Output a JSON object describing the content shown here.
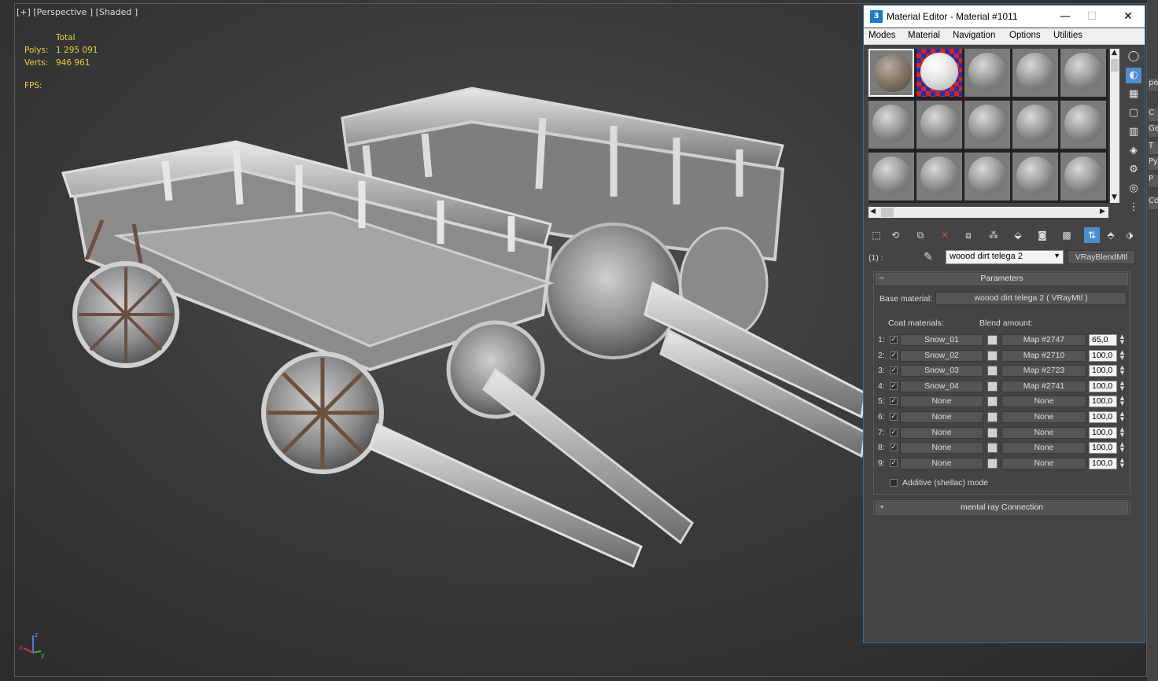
{
  "viewport": {
    "labels": [
      "[+]",
      "[Perspective ]",
      "[Shaded ]"
    ],
    "stats": {
      "header": "Total",
      "polys_label": "Polys:",
      "polys_value": "1 295 091",
      "verts_label": "Verts:",
      "verts_value": "946 961",
      "fps_label": "FPS:"
    },
    "axis": {
      "x": "x",
      "y": "y",
      "z": "z"
    }
  },
  "right_panel": {
    "tabs": [
      "pe",
      "C",
      "Geo",
      "T",
      "Py",
      "P",
      "Colo"
    ]
  },
  "material_editor": {
    "title": "Material Editor - Material #1011",
    "window_buttons": [
      "—",
      "☐",
      "✕"
    ],
    "menu": [
      "Modes",
      "Material",
      "Navigation",
      "Options",
      "Utilities"
    ],
    "slot_label": "(1) :",
    "material_name": "woood dirt telega 2",
    "material_type": "VRayBlendMtl",
    "parameters": {
      "title": "Parameters",
      "base_label": "Base material:",
      "base_value": "woood dirt telega 2  ( VRayMtl )",
      "coat_header": "Coat materials:",
      "blend_header": "Blend amount:",
      "rows": [
        {
          "idx": "1:",
          "coat": "Snow_01",
          "map": "Map #2747",
          "amount": "65,0"
        },
        {
          "idx": "2:",
          "coat": "Snow_02",
          "map": "Map #2710",
          "amount": "100,0"
        },
        {
          "idx": "3:",
          "coat": "Snow_03",
          "map": "Map #2723",
          "amount": "100,0"
        },
        {
          "idx": "4:",
          "coat": "Snow_04",
          "map": "Map #2741",
          "amount": "100,0"
        },
        {
          "idx": "5:",
          "coat": "None",
          "map": "None",
          "amount": "100,0"
        },
        {
          "idx": "6:",
          "coat": "None",
          "map": "None",
          "amount": "100,0"
        },
        {
          "idx": "7:",
          "coat": "None",
          "map": "None",
          "amount": "100,0"
        },
        {
          "idx": "8:",
          "coat": "None",
          "map": "None",
          "amount": "100,0"
        },
        {
          "idx": "9:",
          "coat": "None",
          "map": "None",
          "amount": "100,0"
        }
      ],
      "additive_label": "Additive (shellac) mode"
    },
    "mental_ray": "mental ray Connection",
    "rollout_minus": "−",
    "rollout_plus": "+"
  }
}
